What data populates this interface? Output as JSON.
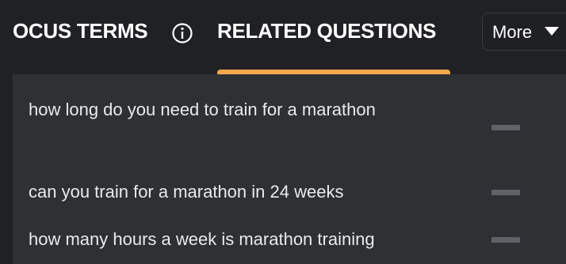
{
  "tabs": {
    "focus_terms_label": "OCUS TERMS",
    "related_questions_label": "RELATED QUESTIONS",
    "active": "RELATED QUESTIONS",
    "more_label": "More"
  },
  "icons": {
    "info": "info-icon",
    "more": "caret-down-icon",
    "row_action": "dash-icon"
  },
  "colors": {
    "accent": "#f2a94e",
    "background": "#202124",
    "panel": "#2e3134"
  },
  "questions": [
    "how long do you need to train for a marathon",
    "can you train for a marathon in 24 weeks",
    "how many hours a week is marathon training"
  ]
}
